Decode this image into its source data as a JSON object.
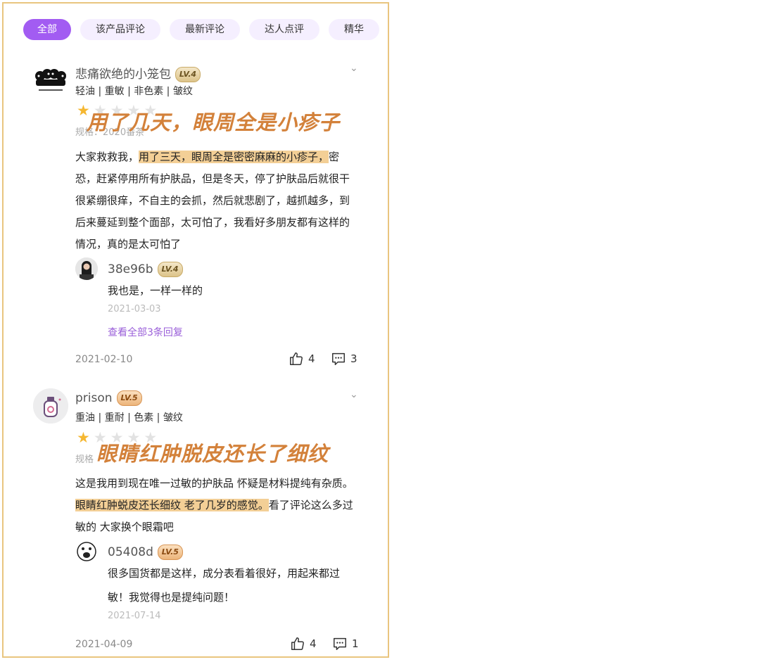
{
  "tabs": [
    "全部",
    "该产品评论",
    "最新评论",
    "达人点评",
    "精华"
  ],
  "reviews": [
    {
      "user": "悲痛欲绝的小笼包",
      "level": "LV.4",
      "tags": "轻油 | 重敏 | 非色素 | 皱纹",
      "rating": 1,
      "spec": "规格：2020番茶",
      "headline": "用了几天，眼周全是小疹子",
      "body_before": "大家救救我，",
      "body_highlight": "用了三天，眼周全是密密麻麻的小疹子，",
      "body_after": "密恐，赶紧停用所有护肤品，但是冬天，停了护肤品后就很干很紧绷很痒，不自主的会抓，然后就悲剧了，越抓越多，到后来蔓延到整个面部，太可怕了，我看好多朋友都有这样的情况，真的是太可怕了",
      "reply": {
        "user": "38e96b",
        "level": "LV.4",
        "text": "我也是，一样一样的",
        "date": "2021-03-03",
        "more": "查看全部3条回复"
      },
      "date": "2021-02-10",
      "likes": "4",
      "comments": "3"
    },
    {
      "user": "prison",
      "level": "LV.5",
      "tags": "重油 | 重耐 | 色素 | 皱纹",
      "rating": 1,
      "spec": "规格",
      "headline": "眼睛红肿脱皮还长了细纹",
      "body_before": "这是我用到现在唯一过敏的护肤品  怀疑是材料提纯有杂质。",
      "body_highlight": "眼睛红肿蜕皮还长细纹 老了几岁的感觉。",
      "body_after": "看了评论这么多过敏的 大家换个眼霜吧",
      "reply": {
        "user": "05408d",
        "level": "LV.5",
        "text": "很多国货都是这样，成分表看着很好，用起来都过敏！我觉得也是提纯问题！",
        "date": "2021-07-14"
      },
      "date": "2021-04-09",
      "likes": "4",
      "comments": "1"
    }
  ],
  "colors": {
    "accent": "#a25cf2",
    "headline": "#d3813a",
    "highlight": "#f3cf96",
    "border": "#e9c57f",
    "star": "#f5b731"
  },
  "icons": [
    "thumbs-up-icon",
    "comment-icon",
    "chevron-down-icon",
    "star-icon"
  ]
}
